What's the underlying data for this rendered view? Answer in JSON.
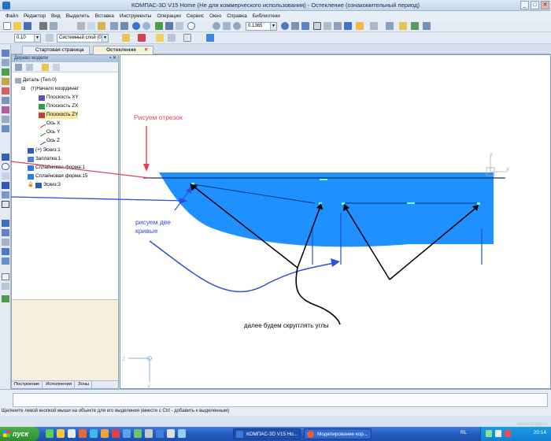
{
  "window": {
    "title": "КОМПАС-3D V15 Home (Не для коммерческого использования) - Остекление (ознакомительный период)"
  },
  "menu": [
    "Файл",
    "Редактор",
    "Вид",
    "Выделить",
    "Вставка",
    "Инструменты",
    "Операции",
    "Сервис",
    "Окно",
    "Справка",
    "Библиотеки"
  ],
  "toolbar": {
    "zoom_value": "0.1365",
    "line_width": "0.10",
    "layer": "Системный слой (0)"
  },
  "tabs": {
    "start_page": "Стартовая страница",
    "document": "Остекление",
    "close": "✕"
  },
  "tree_panel": {
    "header": "Дерево модели",
    "root": "Деталь (Тел-0)",
    "items": [
      {
        "label": "(т)Начало координат"
      },
      {
        "label": "Плоскость XY"
      },
      {
        "label": "Плоскость ZX"
      },
      {
        "label": "Плоскость ZY"
      },
      {
        "label": "Ось X"
      },
      {
        "label": "Ось Y"
      },
      {
        "label": "Ось Z"
      },
      {
        "label": "(+) Эскиз:1"
      },
      {
        "label": "Заплатка:1"
      },
      {
        "label": "Сплайновая форма:1"
      },
      {
        "label": "Сплайновая форма:15"
      },
      {
        "label": "Эскиз:3"
      }
    ],
    "bottom_tabs": [
      "Построение",
      "Исполнения",
      "Зоны"
    ]
  },
  "annotations": {
    "draw_segment": "Рисуем отрезок",
    "draw_curves_line1": "рисуем две",
    "draw_curves_line2": "кривые",
    "round_corners": "далее будем скругглять углы"
  },
  "axis_labels": {
    "z": "Z",
    "y": "Y",
    "x": "X"
  },
  "status": {
    "hint": "Щелкните левой кнопкой мыши на объекте для его выделения (вместе с Ctrl - добавить к выделенным)"
  },
  "taskbar": {
    "start": "пуск",
    "tasks": [
      "КОМПАС-3D V15 Ho...",
      "Моделирование кор..."
    ],
    "lang": "RL",
    "clock": "20:14"
  },
  "watermark": "www.fotojpp.ru",
  "colors": {
    "shape_fill": "#1e90ff",
    "segment_annotation": "#e0455a",
    "curves_annotation": "#2f4fd8",
    "corner_annotation": "#000000"
  }
}
